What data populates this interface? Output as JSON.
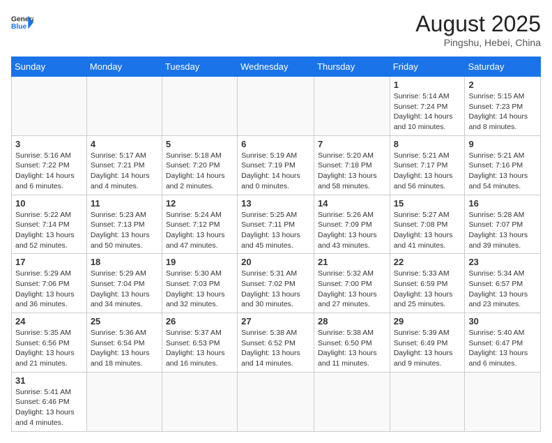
{
  "header": {
    "logo_general": "General",
    "logo_blue": "Blue",
    "month_year": "August 2025",
    "location": "Pingshu, Hebei, China"
  },
  "weekdays": [
    "Sunday",
    "Monday",
    "Tuesday",
    "Wednesday",
    "Thursday",
    "Friday",
    "Saturday"
  ],
  "weeks": [
    [
      {
        "day": "",
        "info": ""
      },
      {
        "day": "",
        "info": ""
      },
      {
        "day": "",
        "info": ""
      },
      {
        "day": "",
        "info": ""
      },
      {
        "day": "",
        "info": ""
      },
      {
        "day": "1",
        "info": "Sunrise: 5:14 AM\nSunset: 7:24 PM\nDaylight: 14 hours and 10 minutes."
      },
      {
        "day": "2",
        "info": "Sunrise: 5:15 AM\nSunset: 7:23 PM\nDaylight: 14 hours and 8 minutes."
      }
    ],
    [
      {
        "day": "3",
        "info": "Sunrise: 5:16 AM\nSunset: 7:22 PM\nDaylight: 14 hours and 6 minutes."
      },
      {
        "day": "4",
        "info": "Sunrise: 5:17 AM\nSunset: 7:21 PM\nDaylight: 14 hours and 4 minutes."
      },
      {
        "day": "5",
        "info": "Sunrise: 5:18 AM\nSunset: 7:20 PM\nDaylight: 14 hours and 2 minutes."
      },
      {
        "day": "6",
        "info": "Sunrise: 5:19 AM\nSunset: 7:19 PM\nDaylight: 14 hours and 0 minutes."
      },
      {
        "day": "7",
        "info": "Sunrise: 5:20 AM\nSunset: 7:18 PM\nDaylight: 13 hours and 58 minutes."
      },
      {
        "day": "8",
        "info": "Sunrise: 5:21 AM\nSunset: 7:17 PM\nDaylight: 13 hours and 56 minutes."
      },
      {
        "day": "9",
        "info": "Sunrise: 5:21 AM\nSunset: 7:16 PM\nDaylight: 13 hours and 54 minutes."
      }
    ],
    [
      {
        "day": "10",
        "info": "Sunrise: 5:22 AM\nSunset: 7:14 PM\nDaylight: 13 hours and 52 minutes."
      },
      {
        "day": "11",
        "info": "Sunrise: 5:23 AM\nSunset: 7:13 PM\nDaylight: 13 hours and 50 minutes."
      },
      {
        "day": "12",
        "info": "Sunrise: 5:24 AM\nSunset: 7:12 PM\nDaylight: 13 hours and 47 minutes."
      },
      {
        "day": "13",
        "info": "Sunrise: 5:25 AM\nSunset: 7:11 PM\nDaylight: 13 hours and 45 minutes."
      },
      {
        "day": "14",
        "info": "Sunrise: 5:26 AM\nSunset: 7:09 PM\nDaylight: 13 hours and 43 minutes."
      },
      {
        "day": "15",
        "info": "Sunrise: 5:27 AM\nSunset: 7:08 PM\nDaylight: 13 hours and 41 minutes."
      },
      {
        "day": "16",
        "info": "Sunrise: 5:28 AM\nSunset: 7:07 PM\nDaylight: 13 hours and 39 minutes."
      }
    ],
    [
      {
        "day": "17",
        "info": "Sunrise: 5:29 AM\nSunset: 7:06 PM\nDaylight: 13 hours and 36 minutes."
      },
      {
        "day": "18",
        "info": "Sunrise: 5:29 AM\nSunset: 7:04 PM\nDaylight: 13 hours and 34 minutes."
      },
      {
        "day": "19",
        "info": "Sunrise: 5:30 AM\nSunset: 7:03 PM\nDaylight: 13 hours and 32 minutes."
      },
      {
        "day": "20",
        "info": "Sunrise: 5:31 AM\nSunset: 7:02 PM\nDaylight: 13 hours and 30 minutes."
      },
      {
        "day": "21",
        "info": "Sunrise: 5:32 AM\nSunset: 7:00 PM\nDaylight: 13 hours and 27 minutes."
      },
      {
        "day": "22",
        "info": "Sunrise: 5:33 AM\nSunset: 6:59 PM\nDaylight: 13 hours and 25 minutes."
      },
      {
        "day": "23",
        "info": "Sunrise: 5:34 AM\nSunset: 6:57 PM\nDaylight: 13 hours and 23 minutes."
      }
    ],
    [
      {
        "day": "24",
        "info": "Sunrise: 5:35 AM\nSunset: 6:56 PM\nDaylight: 13 hours and 21 minutes."
      },
      {
        "day": "25",
        "info": "Sunrise: 5:36 AM\nSunset: 6:54 PM\nDaylight: 13 hours and 18 minutes."
      },
      {
        "day": "26",
        "info": "Sunrise: 5:37 AM\nSunset: 6:53 PM\nDaylight: 13 hours and 16 minutes."
      },
      {
        "day": "27",
        "info": "Sunrise: 5:38 AM\nSunset: 6:52 PM\nDaylight: 13 hours and 14 minutes."
      },
      {
        "day": "28",
        "info": "Sunrise: 5:38 AM\nSunset: 6:50 PM\nDaylight: 13 hours and 11 minutes."
      },
      {
        "day": "29",
        "info": "Sunrise: 5:39 AM\nSunset: 6:49 PM\nDaylight: 13 hours and 9 minutes."
      },
      {
        "day": "30",
        "info": "Sunrise: 5:40 AM\nSunset: 6:47 PM\nDaylight: 13 hours and 6 minutes."
      }
    ],
    [
      {
        "day": "31",
        "info": "Sunrise: 5:41 AM\nSunset: 6:46 PM\nDaylight: 13 hours and 4 minutes."
      },
      {
        "day": "",
        "info": ""
      },
      {
        "day": "",
        "info": ""
      },
      {
        "day": "",
        "info": ""
      },
      {
        "day": "",
        "info": ""
      },
      {
        "day": "",
        "info": ""
      },
      {
        "day": "",
        "info": ""
      }
    ]
  ]
}
